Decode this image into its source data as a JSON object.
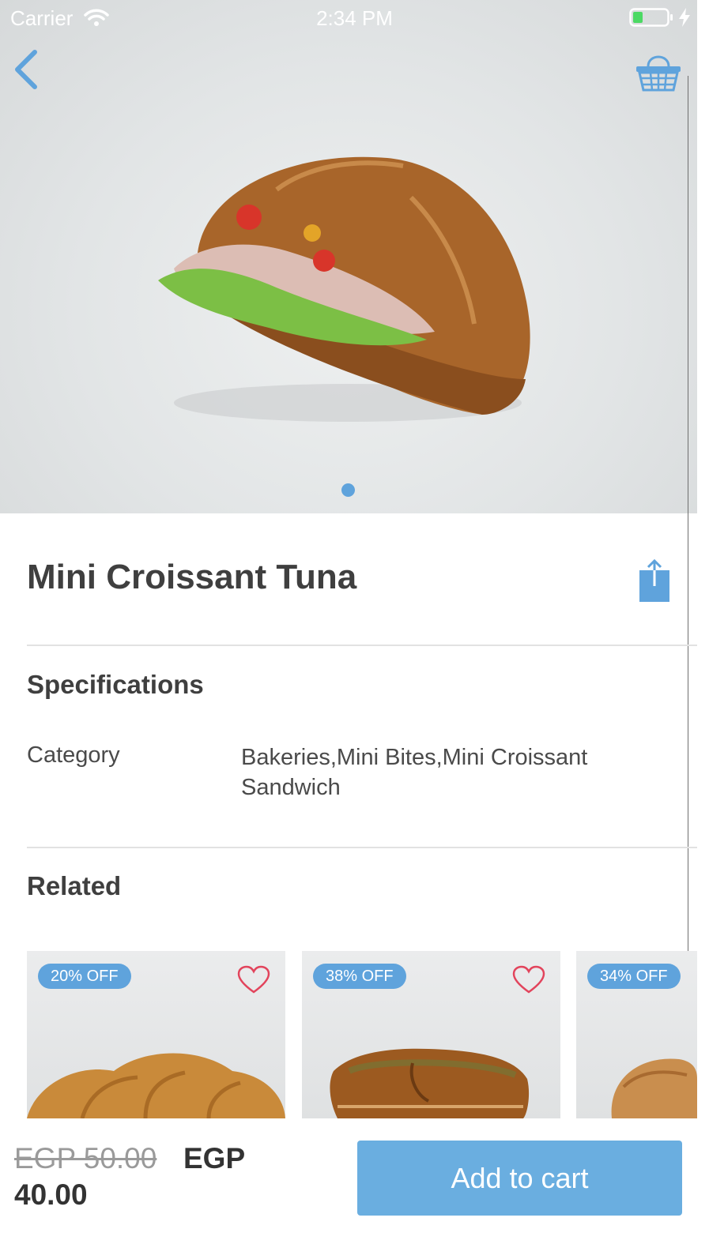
{
  "status_bar": {
    "carrier": "Carrier",
    "time": "2:34 PM"
  },
  "nav": {
    "back_icon": "chevron-left-icon",
    "cart_icon": "basket-icon"
  },
  "hero": {
    "pager_count": 1,
    "pager_active": 0
  },
  "product": {
    "title": "Mini Croissant Tuna",
    "share_icon": "share-icon"
  },
  "specifications": {
    "heading": "Specifications",
    "rows": [
      {
        "key": "Category",
        "value": "Bakeries,Mini Bites,Mini Croissant Sandwich"
      }
    ]
  },
  "related": {
    "heading": "Related",
    "items": [
      {
        "badge": "20% OFF"
      },
      {
        "badge": "38% OFF"
      },
      {
        "badge": "34% OFF"
      }
    ]
  },
  "footer": {
    "old_price": "EGP 50.00",
    "new_price_currency": "EGP",
    "new_price_value": "40.00",
    "add_to_cart": "Add to cart"
  },
  "colors": {
    "accent": "#5fa3dc",
    "button": "#6aaee0",
    "heart": "#e2445c"
  }
}
